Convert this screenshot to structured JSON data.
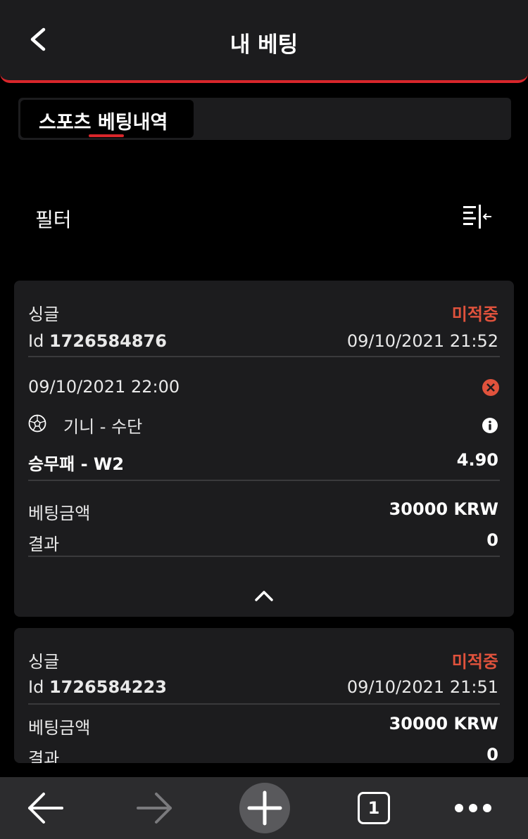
{
  "header": {
    "title": "내 베팅"
  },
  "tabs": [
    {
      "label": "스포츠 베팅내역",
      "active": true
    }
  ],
  "filter": {
    "label": "필터"
  },
  "bets": [
    {
      "type": "싱글",
      "status": "미적중",
      "id_prefix": "Id",
      "id": "1726584876",
      "placed_at": "09/10/2021 21:52",
      "event_time": "09/10/2021 22:00",
      "match": "기니 - 수단",
      "market": "승무패 - W2",
      "odds": "4.90",
      "stake_label": "베팅금액",
      "stake": "30000 KRW",
      "result_label": "결과",
      "result": "0"
    },
    {
      "type": "싱글",
      "status": "미적중",
      "id_prefix": "Id",
      "id": "1726584223",
      "placed_at": "09/10/2021 21:51",
      "stake_label": "베팅금액",
      "stake": "30000 KRW",
      "result_label": "결과",
      "result": "0"
    }
  ],
  "bottom_nav": {
    "tab_count": "1"
  },
  "colors": {
    "accent": "#d8262b",
    "lost": "#e0523c",
    "card": "#1c1c1e",
    "background": "#000000",
    "nav": "#2c2c2e"
  },
  "icons": [
    "back-chevron-icon",
    "filter-collapse-icon",
    "cancel-circle-icon",
    "soccer-ball-icon",
    "info-icon",
    "chevron-up-icon",
    "arrow-left-icon",
    "arrow-right-icon",
    "plus-icon",
    "tabs-icon",
    "more-icon"
  ]
}
